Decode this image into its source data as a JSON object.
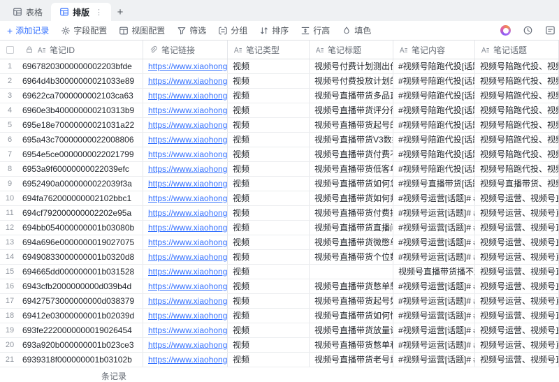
{
  "tabs": {
    "table_label": "表格",
    "layout_label": "排版",
    "more_glyph": "⋮",
    "add_glyph": "+"
  },
  "toolbar": {
    "add_record": "添加记录",
    "field_config": "字段配置",
    "view_config": "视图配置",
    "filter": "筛选",
    "group": "分组",
    "sort": "排序",
    "row_height": "行高",
    "fill_color": "填色"
  },
  "colors": {
    "accent_blue": "#3370ff",
    "grid_line": "#e4e6ea",
    "tabbar_bg": "#eff1f3"
  },
  "table": {
    "header": {
      "id": "笔记ID",
      "link": "笔记链接",
      "type": "笔记类型",
      "title": "笔记标题",
      "content": "笔记内容",
      "topic": "笔记话题"
    },
    "rows": [
      {
        "num": "1",
        "id": "69678203000000002203bfde",
        "link": "https://www.xiaohongs...",
        "type": "视频",
        "title": "视频号付费计划测出价",
        "content": "#视频号陪跑代投[话题]...",
        "topic": "视频号陪跑代投、视频..."
      },
      {
        "num": "2",
        "id": "6964d4b30000000021033e89",
        "link": "https://www.xiaohongs...",
        "type": "视频",
        "title": "视频号付费投放计划的...",
        "content": "#视频号陪跑代投[话题]...",
        "topic": "视频号陪跑代投、视频..."
      },
      {
        "num": "3",
        "id": "69622ca7000000002103ca63",
        "link": "https://www.xiaohongs...",
        "type": "视频",
        "title": "视频号直播带货多品直...",
        "content": "#视频号陪跑代投[话题]...",
        "topic": "视频号陪跑代投、视频..."
      },
      {
        "num": "4",
        "id": "6960e3b400000000210313b9",
        "link": "https://www.xiaohongs...",
        "type": "视频",
        "title": "视频号直播带货评分很...",
        "content": "#视频号陪跑代投[话题]...",
        "topic": "视频号陪跑代投、视频..."
      },
      {
        "num": "5",
        "id": "695e18e70000000021031a22",
        "link": "https://www.xiaohongs...",
        "type": "视频",
        "title": "视频号直播带货起号的...",
        "content": "#视频号陪跑代投[话题]...",
        "topic": "视频号陪跑代投、视频..."
      },
      {
        "num": "6",
        "id": "695a43c70000000022008806",
        "link": "https://www.xiaohongs...",
        "type": "视频",
        "title": "视频号直播带货V3数据...",
        "content": "#视频号陪跑代投[话题]...",
        "topic": "视频号陪跑代投、视频..."
      },
      {
        "num": "7",
        "id": "6954e5ce0000000022021799",
        "link": "https://www.xiaohongs...",
        "type": "视频",
        "title": "视频号直播带货付费不...",
        "content": "#视频号陪跑代投[话题]...",
        "topic": "视频号陪跑代投、视频..."
      },
      {
        "num": "8",
        "id": "6953a9f60000000022039efc",
        "link": "https://www.xiaohongs...",
        "type": "视频",
        "title": "视频号直播带货低客单...",
        "content": "#视频号陪跑代投[话题]...",
        "topic": "视频号陪跑代投、视频..."
      },
      {
        "num": "9",
        "id": "6952490a0000000022039f3a",
        "link": "https://www.xiaohongs...",
        "type": "视频",
        "title": "视频号直播带货如何急...",
        "content": "#视频号直播带货[话题]...",
        "topic": "视频号直播带货、视频..."
      },
      {
        "num": "10",
        "id": "694fa762000000002102bbc1",
        "link": "https://www.xiaohongs...",
        "type": "视频",
        "title": "视频号直播带货如何判...",
        "content": "#视频号运营[话题]# #...",
        "topic": "视频号运营、视频号直..."
      },
      {
        "num": "11",
        "id": "694cf792000000002202e95a",
        "link": "https://www.xiaohongs...",
        "type": "视频",
        "title": "视频号直播带货付费撬...",
        "content": "#视频号运营[话题]# #...",
        "topic": "视频号运营、视频号直..."
      },
      {
        "num": "12",
        "id": "694bb054000000001b03080b",
        "link": "https://www.xiaohongs...",
        "type": "视频",
        "title": "视频号直播带货直播间...",
        "content": "#视频号运营[话题]# #...",
        "topic": "视频号运营、视频号直..."
      },
      {
        "num": "13",
        "id": "694a696e0000000019027075",
        "link": "https://www.xiaohongs...",
        "type": "视频",
        "title": "视频号直播带货微憋单...",
        "content": "#视频号运营[话题]# #...",
        "topic": "视频号运营、视频号直..."
      },
      {
        "num": "14",
        "id": "69490833000000001b0320d8",
        "link": "https://www.xiaohongs...",
        "type": "视频",
        "title": "视频号直播带货个位数...",
        "content": "#视频号运营[话题]# #...",
        "topic": "视频号运营、视频号直..."
      },
      {
        "num": "15",
        "id": "694665dd000000001b031528",
        "link": "https://www.xiaohongs...",
        "type": "视频",
        "title": "",
        "content": "视频号直播带货播不起...",
        "topic": "视频号运营、视频号直..."
      },
      {
        "num": "16",
        "id": "6943cfb2000000000d039b4d",
        "link": "https://www.xiaohongs...",
        "type": "视频",
        "title": "视频号直播带货憋单憋...",
        "content": "#视频号运营[话题]# #...",
        "topic": "视频号运营、视频号直..."
      },
      {
        "num": "17",
        "id": "69427573000000000d038379",
        "link": "https://www.xiaohongs...",
        "type": "视频",
        "title": "视频号直播带货起号如...",
        "content": "#视频号运营[话题]# #...",
        "topic": "视频号运营、视频号直..."
      },
      {
        "num": "18",
        "id": "69412e03000000001b02039d",
        "link": "https://www.xiaohongs...",
        "type": "视频",
        "title": "视频号直播带货如何快...",
        "content": "#视频号运营[话题]# #...",
        "topic": "视频号运营、视频号直..."
      },
      {
        "num": "19",
        "id": "693fe2220000000019026454",
        "link": "https://www.xiaohongs...",
        "type": "视频",
        "title": "视频号直播带货放量计...",
        "content": "#视频号运营[话题]# #...",
        "topic": "视频号运营、视频号直..."
      },
      {
        "num": "20",
        "id": "693a920b000000001b023ce3",
        "link": "https://www.xiaohongs...",
        "type": "视频",
        "title": "视频号直播带货憋单和...",
        "content": "#视频号运营[话题]# #...",
        "topic": "视频号运营、视频号直..."
      },
      {
        "num": "21",
        "id": "6939318f000000001b03102b",
        "link": "https://www.xiaohongs...",
        "type": "视频",
        "title": "视频号直播带货老号重...",
        "content": "#视频号运营[话题]# #...",
        "topic": "视频号运营、视频号直..."
      }
    ]
  },
  "footer": {
    "record_count_label": "条记录"
  }
}
